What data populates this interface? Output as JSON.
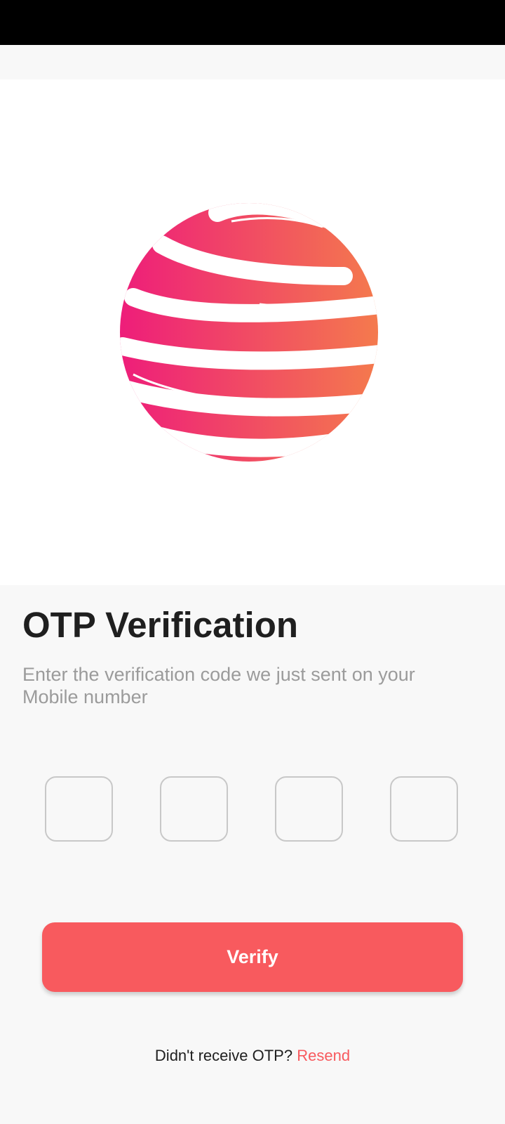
{
  "colors": {
    "accent": "#f85a5e",
    "logo_gradient_start": "#ee1d7a",
    "logo_gradient_end": "#f47a4d",
    "title": "#1f1f1f",
    "subtitle": "#9b9b9b"
  },
  "logo": {
    "icon": "striped-globe-logo-icon"
  },
  "content": {
    "title": "OTP Verification",
    "subtitle": "Enter the verification code we just sent on your Mobile number"
  },
  "otp": {
    "digits": [
      "",
      "",
      "",
      ""
    ]
  },
  "actions": {
    "verify_label": "Verify",
    "resend_prompt": "Didn't receive OTP?",
    "resend_label": "Resend"
  }
}
